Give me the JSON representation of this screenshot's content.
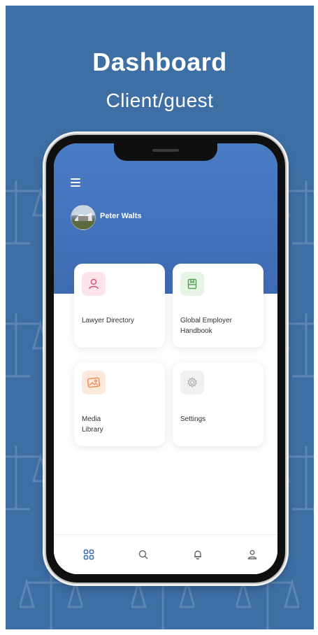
{
  "hero": {
    "title": "Dashboard",
    "subtitle": "Client/guest"
  },
  "user": {
    "name": "Peter Walts"
  },
  "cards": [
    {
      "label": "Lawyer Directory",
      "icon": "person-icon",
      "icon_bg": "#fde3ea",
      "icon_color": "#e0506f"
    },
    {
      "label": "Global Employer Handbook",
      "icon": "book-icon",
      "icon_bg": "#e6f5e4",
      "icon_color": "#58a55a"
    },
    {
      "label": "Media Library",
      "icon": "image-icon",
      "icon_bg": "#fde8dc",
      "icon_color": "#e9935f"
    },
    {
      "label": "Settings",
      "icon": "gear-icon",
      "icon_bg": "#f1f1f1",
      "icon_color": "#b3b3b3"
    }
  ],
  "bottom_nav": [
    {
      "icon": "grid-icon",
      "active": true
    },
    {
      "icon": "search-icon",
      "active": false
    },
    {
      "icon": "bell-icon",
      "active": false
    },
    {
      "icon": "profile-icon",
      "active": false
    }
  ],
  "colors": {
    "background": "#3d6fa5",
    "header": "#4a7cc6",
    "active_nav": "#3e6bb2",
    "inactive_nav": "#666666"
  }
}
